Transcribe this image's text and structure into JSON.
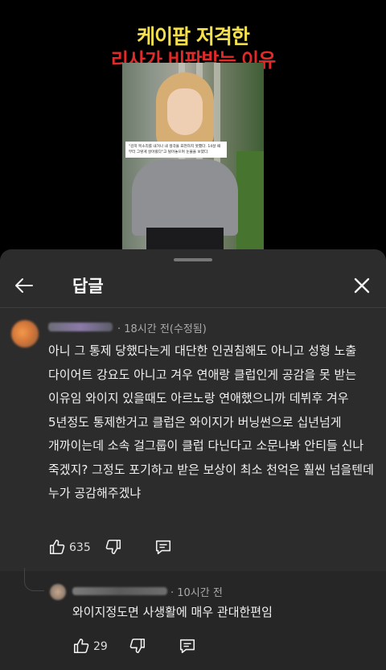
{
  "video": {
    "title_line1": "케이팝 저격한",
    "title_line2": "리사가 비판받는 이유",
    "caption": "\"감히 목소리를 내거나 내 생각을 표현하지 못했다. 14살 때부터 그렇게 살아왔다\"고 털어놓으며 눈물을 보였다."
  },
  "panel": {
    "title": "답글",
    "back_icon": "arrow-left-icon",
    "close_icon": "close-icon"
  },
  "comment": {
    "time": "· 18시간 전(수정됨)",
    "text": "아니 그 통제 당했다는게 대단한 인권침해도 아니고 성형 노출 다이어트 강요도 아니고 겨우 연애랑 클럽인게 공감을 못 받는 이유임 와이지 있을때도 아르노랑 연애했으니까 데뷔후 겨우 5년정도 통제한거고 클럽은 와이지가 버닝썬으로 십년넘게 개까이는데 소속 걸그룹이 클럽 다닌다고 소문나봐 안티들 신나 죽겠지? 그정도 포기하고 받은 보상이 최소 천억은 훨씬 넘을텐데 누가 공감해주겠냐",
    "likes": "635"
  },
  "reply": {
    "time": "· 10시간 전",
    "text": "와이지정도면 사생활에 매우 관대한편임",
    "likes": "29"
  },
  "colors": {
    "title_yellow": "#f7e14a",
    "title_red": "#e22a2a",
    "panel_bg": "#2c2c2c"
  }
}
